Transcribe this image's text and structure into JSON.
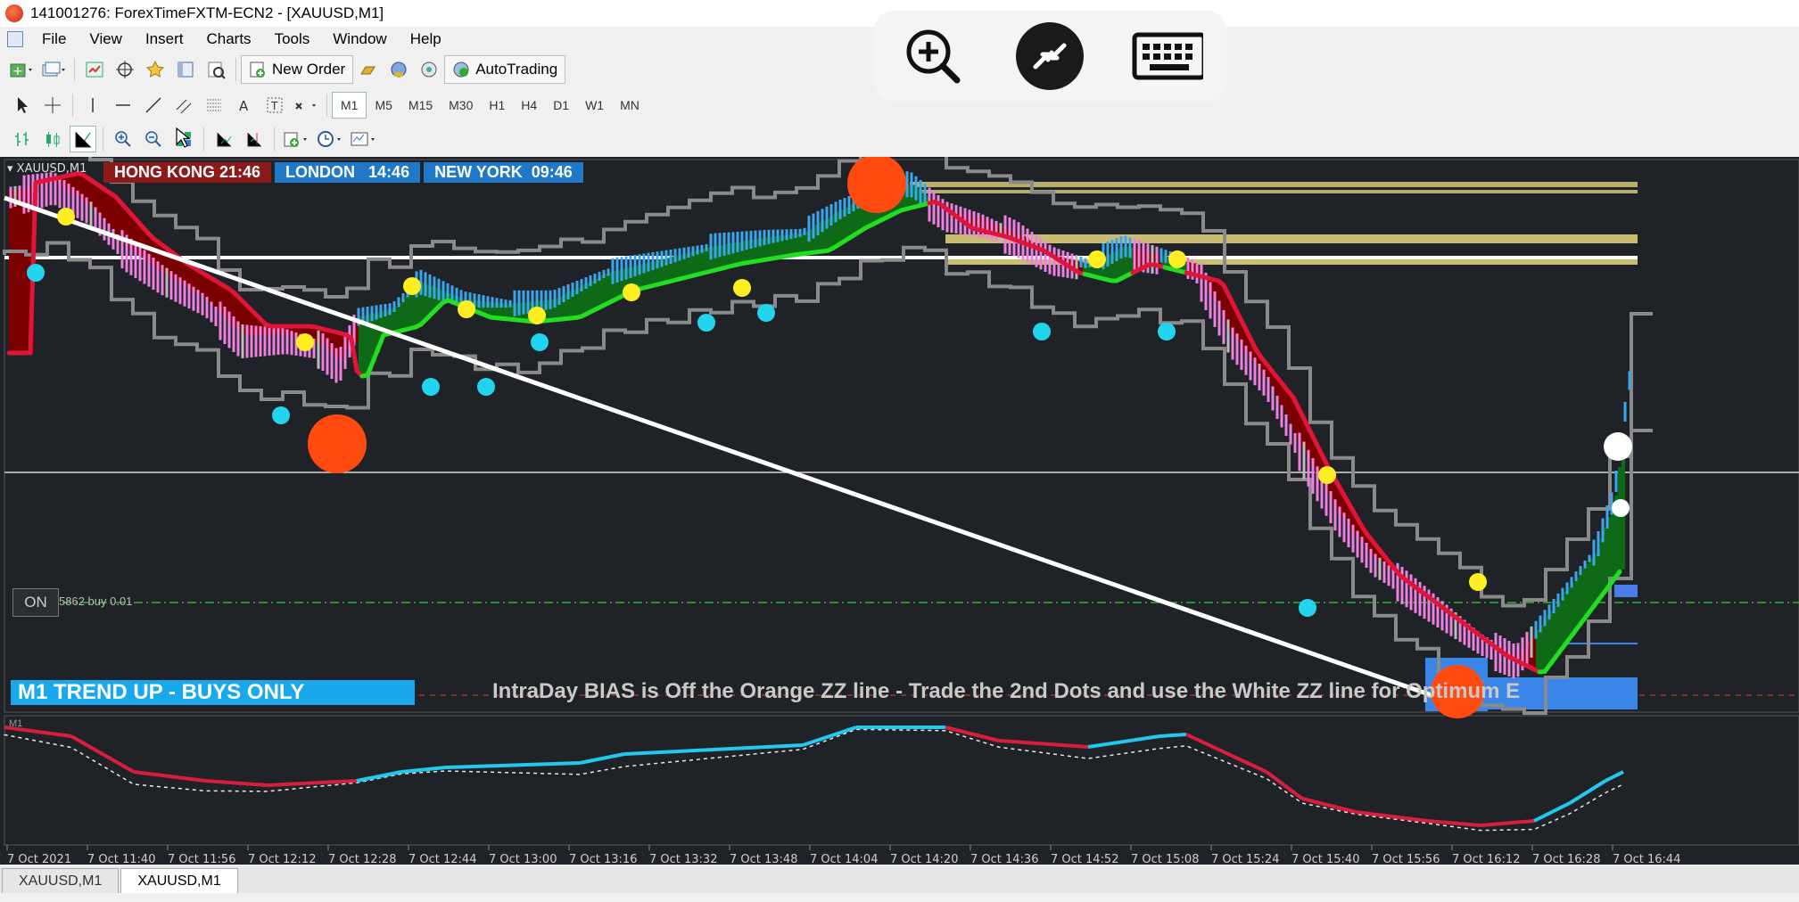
{
  "window": {
    "title": "141001276: ForexTimeFXTM-ECN2 - [XAUUSD,M1]"
  },
  "menu": [
    "File",
    "View",
    "Insert",
    "Charts",
    "Tools",
    "Window",
    "Help"
  ],
  "toolbar": {
    "new_order": "New Order",
    "autotrading": "AutoTrading"
  },
  "timeframes": [
    "M1",
    "M5",
    "M15",
    "M30",
    "H1",
    "H4",
    "D1",
    "W1",
    "MN"
  ],
  "active_timeframe": "M1",
  "remote_controls": {
    "zoom": "zoom-in-icon",
    "connection": "remote-connection-icon",
    "keyboard": "keyboard-icon"
  },
  "chart": {
    "symbol_label": "XAUUSD,M1",
    "clocks": [
      {
        "label": "HONG KONG 21:46",
        "color": "#8b1b1b"
      },
      {
        "label": "LONDON   14:46",
        "color": "#1f78c8"
      },
      {
        "label": "NEW YORK  09:46",
        "color": "#1f78c8"
      }
    ],
    "on_button": "ON",
    "order_label": "5862 buy 0.01",
    "trend_banner": "M1 TREND UP - BUYS ONLY",
    "bias_text": "IntraDay BIAS is Off the Orange ZZ line - Trade the 2nd Dots and use the White ZZ line for Optimum E",
    "indicator_label": "M1",
    "time_axis": [
      "7 Oct 2021",
      "7 Oct 11:40",
      "7 Oct 11:56",
      "7 Oct 12:12",
      "7 Oct 12:28",
      "7 Oct 12:44",
      "7 Oct 13:00",
      "7 Oct 13:16",
      "7 Oct 13:32",
      "7 Oct 13:48",
      "7 Oct 14:04",
      "7 Oct 14:20",
      "7 Oct 14:36",
      "7 Oct 14:52",
      "7 Oct 15:08",
      "7 Oct 15:24",
      "7 Oct 15:40",
      "7 Oct 15:56",
      "7 Oct 16:12",
      "7 Oct 16:28",
      "7 Oct 16:44"
    ],
    "colors": {
      "background": "#1f2226",
      "up_fill": "#0f6a18",
      "down_fill": "#7a0000",
      "ma_up": "#22dd22",
      "ma_down": "#e0153a",
      "channel": "#8a8a8a",
      "dot_yellow": "#ffee22",
      "dot_cyan": "#22d4ee",
      "zz_orange": "#ff4a10",
      "trend_banner_bg": "#19a8ec"
    }
  },
  "tabs": [
    "XAUUSD,M1",
    "XAUUSD,M1"
  ],
  "active_tab": 1
}
